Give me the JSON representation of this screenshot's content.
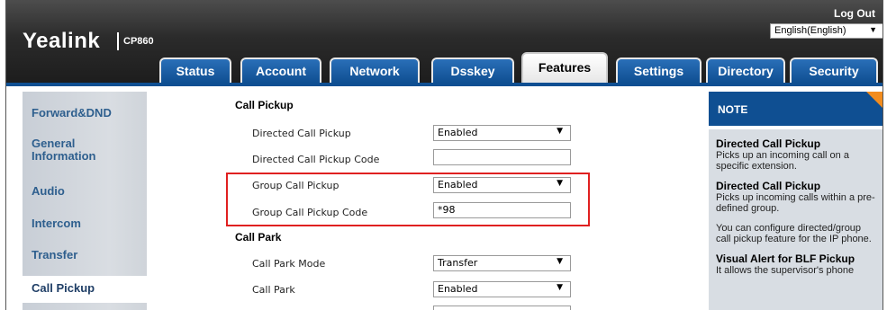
{
  "header": {
    "logo": "Yealink",
    "model": "CP860",
    "logout": "Log Out",
    "language": "English(English)"
  },
  "tabs": [
    {
      "label": "Status"
    },
    {
      "label": "Account"
    },
    {
      "label": "Network"
    },
    {
      "label": "Dsskey"
    },
    {
      "label": "Features"
    },
    {
      "label": "Settings"
    },
    {
      "label": "Directory"
    },
    {
      "label": "Security"
    }
  ],
  "sidebar": {
    "items": [
      {
        "label": "Forward&DND"
      },
      {
        "label": "General Information"
      },
      {
        "label": "Audio"
      },
      {
        "label": "Intercom"
      },
      {
        "label": "Transfer"
      },
      {
        "label": "Call Pickup"
      }
    ]
  },
  "form": {
    "call_pickup": {
      "title": "Call Pickup",
      "directed_label": "Directed Call Pickup",
      "directed_value": "Enabled",
      "directed_code_label": "Directed Call Pickup Code",
      "directed_code_value": "",
      "group_label": "Group Call Pickup",
      "group_value": "Enabled",
      "group_code_label": "Group Call Pickup Code",
      "group_code_value": "*98"
    },
    "call_park": {
      "title": "Call Park",
      "mode_label": "Call Park Mode",
      "mode_value": "Transfer",
      "park_label": "Call Park",
      "park_value": "Enabled"
    }
  },
  "note": {
    "title": "NOTE",
    "entries": [
      {
        "heading": "Directed Call Pickup",
        "text": "Picks up an incoming call on a specific extension."
      },
      {
        "heading": "Directed Call Pickup",
        "text": "Picks up incoming calls within a pre-defined group."
      },
      {
        "heading": "",
        "text": "You can configure directed/group call pickup feature for the IP phone."
      },
      {
        "heading": "Visual Alert for BLF Pickup",
        "text": "It allows the supervisor's phone"
      }
    ]
  },
  "colors": {
    "tab_blue": "#0f4f92",
    "highlight_red": "#e02020",
    "note_corner": "#f28c1e",
    "sidebar_text": "#2e5f8e"
  }
}
